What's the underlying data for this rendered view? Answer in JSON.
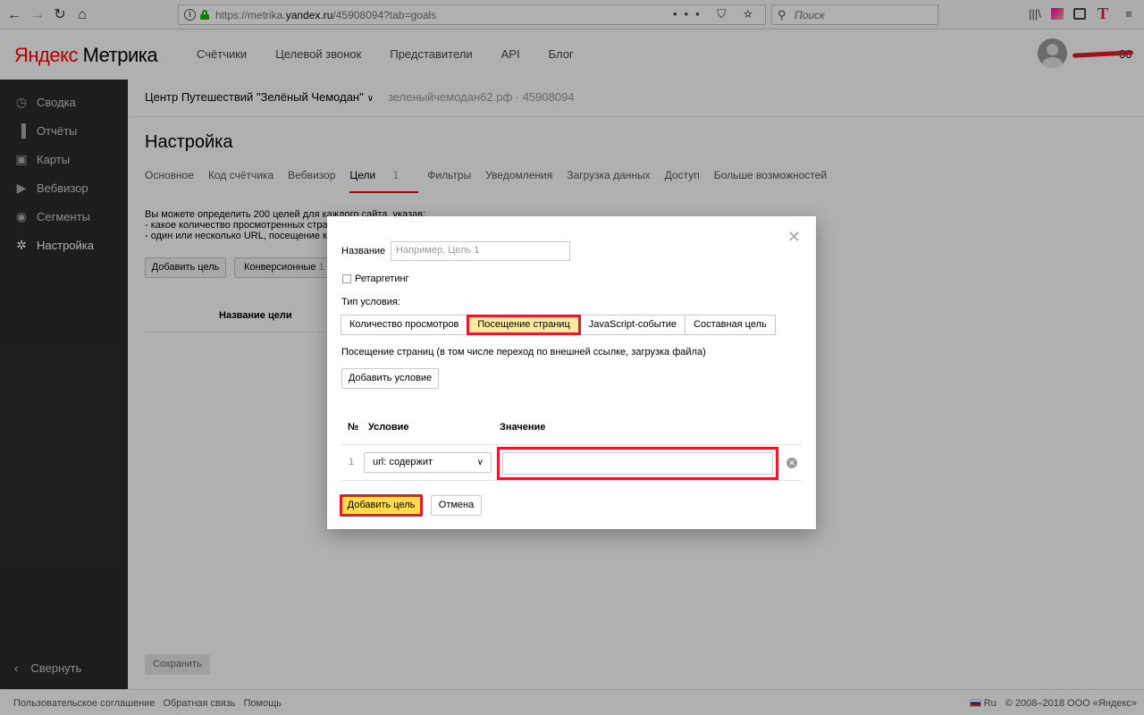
{
  "browser": {
    "url_prefix": "https://metrika.",
    "url_domain": "yandex.ru",
    "url_path": "/45908094?tab=goals",
    "search_placeholder": "Поиск",
    "url_actions": "••• ⛉ ☆",
    "toolbar_icons": [
      "library-icon",
      "color-icon",
      "sidebar-icon",
      "t-extension-icon"
    ]
  },
  "header": {
    "logo_first": "Яндекс",
    "logo_second": " Метрика",
    "nav": [
      "Счётчики",
      "Целевой звонок",
      "Представители",
      "API",
      "Блог"
    ],
    "user_suffix": "00"
  },
  "sidebar": {
    "items": [
      {
        "label": "Сводка",
        "icon": "clock-icon"
      },
      {
        "label": "Отчёты",
        "icon": "bar-chart-icon"
      },
      {
        "label": "Карты",
        "icon": "map-icon"
      },
      {
        "label": "Вебвизор",
        "icon": "play-icon"
      },
      {
        "label": "Сегменты",
        "icon": "segments-icon"
      },
      {
        "label": "Настройка",
        "icon": "gear-icon"
      }
    ],
    "collapse_label": "Свернуть"
  },
  "main": {
    "counter_name": "Центр Путешествий \"Зелёный Чемодан\"",
    "counter_site": "зеленыйчемодан62.рф · 45908094",
    "title": "Настройка",
    "tabs": [
      {
        "label": "Основное"
      },
      {
        "label": "Код счётчика"
      },
      {
        "label": "Вебвизор"
      },
      {
        "label": "Цели",
        "count": "1"
      },
      {
        "label": "Фильтры"
      },
      {
        "label": "Уведомления"
      },
      {
        "label": "Загрузка данных"
      },
      {
        "label": "Доступ"
      },
      {
        "label": "Больше возможностей"
      }
    ],
    "desc_lines": [
      "Вы можете определить 200 целей для каждого сайта, указав:",
      "-  какое количество просмотренных стран",
      "-  один или несколько URL, посещение кото"
    ],
    "add_goal_label": "Добавить цель",
    "conversion_label": "Конверсионные",
    "conversion_count": "1",
    "goal_name_header": "Название цели",
    "save_label": "Сохранить"
  },
  "modal": {
    "name_label": "Название",
    "name_placeholder": "Например, Цель 1",
    "retargeting_label": "Ретаргетинг",
    "condition_type_label": "Тип условия:",
    "condition_types": [
      "Количество просмотров",
      "Посещение страниц",
      "JavaScript-событие",
      "Составная цель"
    ],
    "selected_condition": 1,
    "condition_desc": "Посещение страниц (в том числе переход по внешней ссылке, загрузка файла)",
    "add_condition_label": "Добавить условие",
    "col_num": "№",
    "col_condition": "Условие",
    "col_value": "Значение",
    "row_num": "1",
    "row_select": "url: содержит",
    "row_value": "",
    "submit_label": "Добавить цель",
    "cancel_label": "Отмена"
  },
  "footer": {
    "links": [
      "Пользовательское соглашение",
      "Обратная связь",
      "Помощь"
    ],
    "lang": "Ru",
    "copyright": "© 2008–2018 ООО «Яндекс»"
  },
  "colors": {
    "accent_red": "#e8192c",
    "yellow_button": "#ffdb4d",
    "sidebar_bg": "#2b2b2b"
  }
}
